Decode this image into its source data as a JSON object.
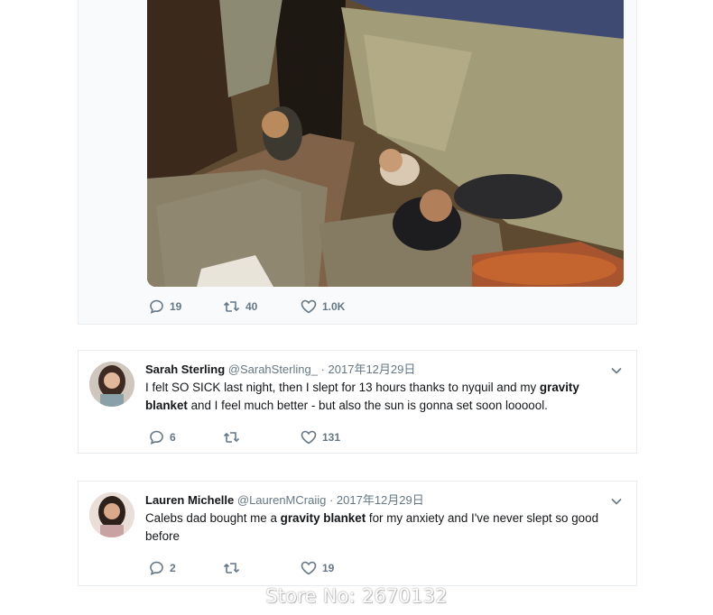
{
  "top_tweet": {
    "stats": {
      "replies": "19",
      "retweets": "40",
      "likes": "1.0K"
    }
  },
  "tweets": [
    {
      "name": "Sarah Sterling",
      "handle": "@SarahSterling_",
      "date": "2017年12月29日",
      "text_parts": [
        "I felt SO SICK last night, then I slept for 13 hours thanks to nyquil and my ",
        "gravity blanket",
        " and I feel much better - but also the sun is gonna set soon loooool."
      ],
      "stats": {
        "replies": "6",
        "retweets": "",
        "likes": "131"
      }
    },
    {
      "name": "Lauren Michelle",
      "handle": "@LaurenMCraiig",
      "date": "2017年12月29日",
      "text_parts": [
        "Calebs dad bought me a ",
        "gravity blanket",
        " for my anxiety and I've never slept so good before"
      ],
      "stats": {
        "replies": "2",
        "retweets": "",
        "likes": "19"
      }
    }
  ],
  "separator": " · ",
  "watermark": "Store No: 2670132",
  "icons": {
    "reply": "reply-icon",
    "retweet": "retweet-icon",
    "like": "heart-icon",
    "caret": "chevron-down-icon"
  },
  "colors": {
    "muted": "#657786",
    "text": "#14171a",
    "border": "#e6ecf0"
  }
}
